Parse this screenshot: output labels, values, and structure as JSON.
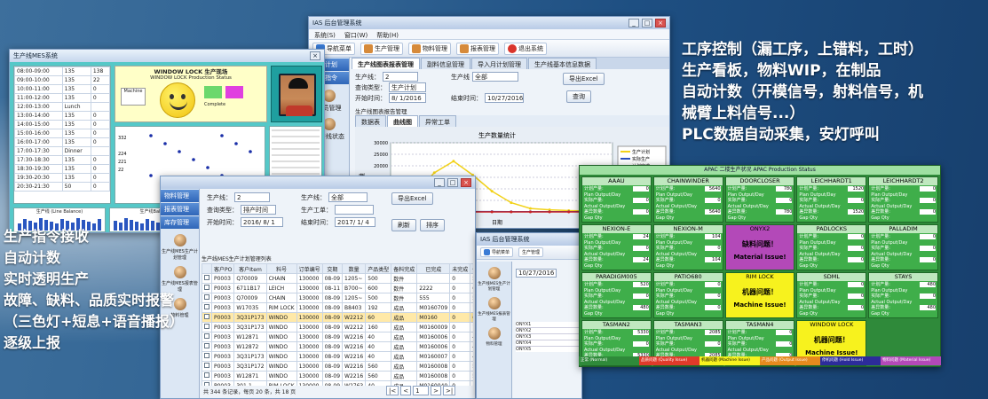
{
  "headline_right": {
    "lines": [
      "工序控制（漏工序，上错料，工时）",
      "生产看板，物料WIP，在制品",
      "自动计数（开模信号，射料信号，机",
      "械臂上料信号...）",
      "PLC数据自动采集，安灯呼叫"
    ]
  },
  "headline_left": {
    "lines": [
      "生产指令接收",
      "自动计数",
      "实时透明生产",
      "故障、缺料、品质实时报警",
      "（三色灯+短息+语音播报）",
      "逐级上报"
    ]
  },
  "win_top": {
    "title": "IAS 后台管理系统",
    "menu": [
      "系统(S)",
      "窗口(W)",
      "帮助(H)"
    ],
    "toolbar": [
      "导航菜单",
      "生产管理",
      "物料管理",
      "报表管理",
      "退出系统"
    ],
    "side": [
      "生产计划",
      "生产指令",
      "人员管理",
      "生产线状态"
    ],
    "tabs": [
      "生产线图表报表管理",
      "副料信息管理",
      "导入月计划管理",
      "生产线基本信息数据",
      "车间基本信息数据",
      "生产线基本信息录入"
    ],
    "form": {
      "line_label": "生产线：",
      "line_value": "2",
      "query_label": "查询类型：",
      "query_value": "生产计划",
      "start_label": "开始时间：",
      "start_value": "8/ 1/2016",
      "end_label": "结束时间：",
      "end_value": "10/27/2016",
      "worker_label": "生产线",
      "worker_value": "全部",
      "export_btn": "导出Excel",
      "query_btn": "查询"
    },
    "subtab_header": "生产线图表报告管理",
    "subtabs": [
      "数据表",
      "曲线图",
      "异常工单"
    ],
    "chart_title": "生产数量统计",
    "chart_legend": [
      "生产计划",
      "实际生产",
      "计划完成"
    ],
    "chart_xlabel": "日期",
    "chart_ylabel": "数量"
  },
  "chart_data": {
    "type": "line",
    "title": "生产数量统计",
    "xlabel": "日期",
    "ylabel": "数量",
    "ylim": [
      0,
      30000
    ],
    "yticks": [
      0,
      5000,
      10000,
      15000,
      20000,
      25000,
      30000
    ],
    "x": [
      1,
      2,
      3,
      4,
      5,
      6,
      7,
      8,
      9,
      10,
      11,
      12
    ],
    "series": [
      {
        "name": "生产计划",
        "color": "#f2d21a",
        "values": [
          3000,
          8000,
          17000,
          22000,
          16000,
          9000,
          4000,
          1500,
          900,
          600,
          400,
          300
        ]
      },
      {
        "name": "实际生产",
        "color": "#2a4fbf",
        "values": [
          300,
          200,
          200,
          150,
          150,
          150,
          100,
          100,
          100,
          100,
          100,
          100
        ]
      },
      {
        "name": "计划完成",
        "color": "#cc2222",
        "values": [
          0,
          0,
          0,
          0,
          0,
          0,
          0,
          0,
          0,
          0,
          0,
          0
        ]
      }
    ]
  },
  "win_left": {
    "title": "生产线MES系统",
    "headline": "WINDOW LOCK 生产现场",
    "subheadline": "WINDOW LOCK Production Status",
    "schedule": [
      [
        "08:00-09:00",
        "135",
        "138"
      ],
      [
        "09:00-10:00",
        "135",
        "22"
      ],
      [
        "10:00-11:00",
        "135",
        "0"
      ],
      [
        "11:00-12:00",
        "135",
        "0"
      ],
      [
        "12:00-13:00",
        "Lunch",
        ""
      ],
      [
        "13:00-14:00",
        "135",
        "0"
      ],
      [
        "14:00-15:00",
        "135",
        "0"
      ],
      [
        "15:00-16:00",
        "135",
        "0"
      ],
      [
        "16:00-17:00",
        "135",
        "0"
      ],
      [
        "17:00-17:30",
        "Dinner",
        ""
      ],
      [
        "17:30-18:30",
        "135",
        "0"
      ],
      [
        "18:30-19:30",
        "135",
        "0"
      ],
      [
        "19:30-20:30",
        "135",
        "0"
      ],
      [
        "20:30-21:30",
        "50",
        "0"
      ]
    ],
    "counts": [
      "332",
      "",
      "224",
      "221",
      "22"
    ],
    "bottom_left": "生产线 (Line Balance)",
    "bottom_mid": "生产线Balance",
    "center_label": "Machine",
    "status_label": "Complete",
    "plan_value": "0"
  },
  "win_mid": {
    "form": {
      "line_label": "生产线：",
      "line_value": "2",
      "query_label": "查询类型：",
      "query_value": "排产时间",
      "start_label": "开始时间：",
      "start_value": "2016/ 8/ 1",
      "worker_label": "生产工单：",
      "end_label": "结束时间：",
      "end_value": "2017/ 1/ 4",
      "ws_label": "生产线：",
      "ws_value": "全部",
      "export_btn": "导出Excel",
      "b2": "刷新",
      "b3": "排序"
    },
    "grid_title": "生产线MES生产计划管理列表",
    "side": [
      "物料管理",
      "报表管理",
      "库存管理",
      "生产线MES生产计划管理",
      "生产线MES报表管理",
      "物料管理"
    ],
    "columns": [
      "",
      "客户PO",
      "客户Item",
      "料号",
      "订单编号",
      "交期",
      "数量",
      "产品类型",
      "备料完成",
      "已完成",
      "未完成",
      "备注",
      "开工"
    ],
    "rows": [
      [
        "",
        "P0003",
        "Q70009",
        "CHAIN",
        "130000",
        "08-09",
        "1205~",
        "500",
        "数件",
        "",
        "0",
        "500",
        "2016/"
      ],
      [
        "",
        "P0003",
        "6711B17",
        "LEICH",
        "130000",
        "08-11",
        "B700~",
        "600",
        "数件",
        "2222",
        "0",
        "600",
        "2016/"
      ],
      [
        "",
        "P0003",
        "Q70009",
        "CHAIN",
        "130000",
        "08-09",
        "1205~",
        "500",
        "数件",
        "555",
        "0",
        "500",
        "2016/"
      ],
      [
        "",
        "P0003",
        "W17035",
        "RIM LOCK",
        "130000",
        "08-09",
        "B8403",
        "192",
        "成品",
        "M0160709",
        "0",
        "192",
        "2016/"
      ],
      [
        "",
        "P0003",
        "3Q31P173",
        "WINDO",
        "130000",
        "08-09",
        "W2212",
        "60",
        "成品",
        "M0160",
        "0",
        "60",
        "2016/"
      ],
      [
        "",
        "P0003",
        "3Q31P173",
        "WINDO",
        "130000",
        "08-09",
        "W2212",
        "160",
        "成品",
        "M0160009",
        "0",
        "160",
        "2016/"
      ],
      [
        "",
        "P0003",
        "W12871",
        "WINDO",
        "130000",
        "08-09",
        "W2216",
        "40",
        "成品",
        "M0160006",
        "0",
        "40",
        "2016/"
      ],
      [
        "",
        "P0003",
        "W12872",
        "WINDO",
        "130000",
        "08-09",
        "W2216",
        "40",
        "成品",
        "M0160006",
        "0",
        "40",
        "2016/"
      ],
      [
        "",
        "P0003",
        "3Q31P173",
        "WINDO",
        "130000",
        "08-09",
        "W2216",
        "40",
        "成品",
        "M0160007",
        "0",
        "40",
        "2016/"
      ],
      [
        "",
        "P0003",
        "3Q31P172",
        "WINDO",
        "130000",
        "08-09",
        "W2216",
        "560",
        "成品",
        "M0160008",
        "0",
        "560",
        "2016/"
      ],
      [
        "",
        "P0003",
        "W12871",
        "WINDO",
        "130000",
        "08-09",
        "W2216",
        "560",
        "成品",
        "M0160008",
        "0",
        "560",
        "2016/"
      ],
      [
        "",
        "P0003",
        "301-1",
        "RIM LOCK",
        "130000",
        "08-09",
        "W2763",
        "40",
        "成品",
        "M0160040",
        "0",
        "40",
        "2016/"
      ],
      [
        "",
        "P0003",
        "301-1",
        "RIM LOCK",
        "130000",
        "08-09",
        "W2763",
        "40",
        "成品",
        "M0160040",
        "0",
        "40",
        "2016/"
      ]
    ],
    "footer": "共 344 条记录，每页 20 条，共 18 页"
  },
  "win_small": {
    "title": "IAS 后台管理系统",
    "toolbar": [
      "导航菜单",
      "生产管理",
      "物料管理"
    ],
    "side_items": [
      "生产线MES生产计划管理",
      "生产线MES报表管理",
      "物料管理"
    ],
    "rows": [
      "ONYX1",
      "ONYX2",
      "ONYX3",
      "ONYX4",
      "ONYX5"
    ],
    "date": "10/27/2016"
  },
  "andon": {
    "title": "APAC 二楼生产状况 APAC Production Status",
    "field_labels": [
      "计划产量:",
      "Plan Output/Day",
      "实际产量:",
      "Actual Output/Day",
      "差异数量:",
      "Gap Qty"
    ],
    "cells": [
      {
        "name": "AAAU",
        "vals": [
          "0",
          "0",
          "0"
        ],
        "state": "ok"
      },
      {
        "name": "CHAINWINDER",
        "vals": [
          "5640",
          "0",
          "5640"
        ],
        "state": "ok"
      },
      {
        "name": "DOORCLOSER",
        "vals": [
          "780",
          "0",
          "780"
        ],
        "state": "ok"
      },
      {
        "name": "LEICHHARDT1",
        "vals": [
          "1520",
          "0",
          "1520"
        ],
        "state": "ok"
      },
      {
        "name": "LEICHHARDT2",
        "vals": [
          "0",
          "0",
          "0"
        ],
        "state": "ok"
      },
      {
        "name": "NEXION-E",
        "vals": [
          "24",
          "0",
          "24"
        ],
        "state": "ok"
      },
      {
        "name": "NEXION-M",
        "vals": [
          "104",
          "0",
          "104"
        ],
        "state": "ok"
      },
      {
        "name": "ONYX2",
        "vals": [],
        "state": "purple",
        "issue1": "缺料问题！",
        "issue2": "Material Issue!"
      },
      {
        "name": "PADLOCKS",
        "vals": [
          "0",
          "0",
          "0"
        ],
        "state": "ok"
      },
      {
        "name": "PALLADIM",
        "vals": [
          "0",
          "0",
          "0"
        ],
        "state": "ok"
      },
      {
        "name": "PARADIGM005",
        "vals": [
          "520",
          "0",
          "480"
        ],
        "state": "ok"
      },
      {
        "name": "PATIO680",
        "vals": [
          "0",
          "0",
          "0"
        ],
        "state": "ok"
      },
      {
        "name": "RIM LOCK",
        "vals": [],
        "state": "yellow",
        "issue1": "机器问题！",
        "issue2": "Machine Issue!"
      },
      {
        "name": "SDML",
        "vals": [
          "0",
          "0",
          "0"
        ],
        "state": "ok"
      },
      {
        "name": "STAYS",
        "vals": [
          "480",
          "0",
          "480"
        ],
        "state": "ok"
      },
      {
        "name": "TASMAN2",
        "vals": [
          "5330",
          "0",
          "5330"
        ],
        "state": "ok"
      },
      {
        "name": "TASMAN3",
        "vals": [
          "2085",
          "0",
          "2085"
        ],
        "state": "ok"
      },
      {
        "name": "TASMAN4",
        "vals": [
          "0",
          "0",
          "0"
        ],
        "state": "ok"
      },
      {
        "name": "WINDOW LOCK",
        "vals": [],
        "state": "yellow",
        "issue1": "机器问题！",
        "issue2": "Machine Issue!"
      },
      {
        "name": "",
        "vals": [],
        "state": "blank"
      }
    ],
    "legend": [
      {
        "text": "正常 (Normal)",
        "color": "#2f8a3a"
      },
      {
        "text": "品质问题 (Quality Issue)",
        "color": "#e03a2a"
      },
      {
        "text": "机器问题 (Machine Issue)",
        "color": "#f7f21e"
      },
      {
        "text": "产品问题 (Output Issue)",
        "color": "#e68a1e"
      },
      {
        "text": "停机问题 (Hold Issue)",
        "color": "#2c2c9a"
      },
      {
        "text": "物料问题 (Material Issue)",
        "color": "#b349b8"
      }
    ]
  }
}
